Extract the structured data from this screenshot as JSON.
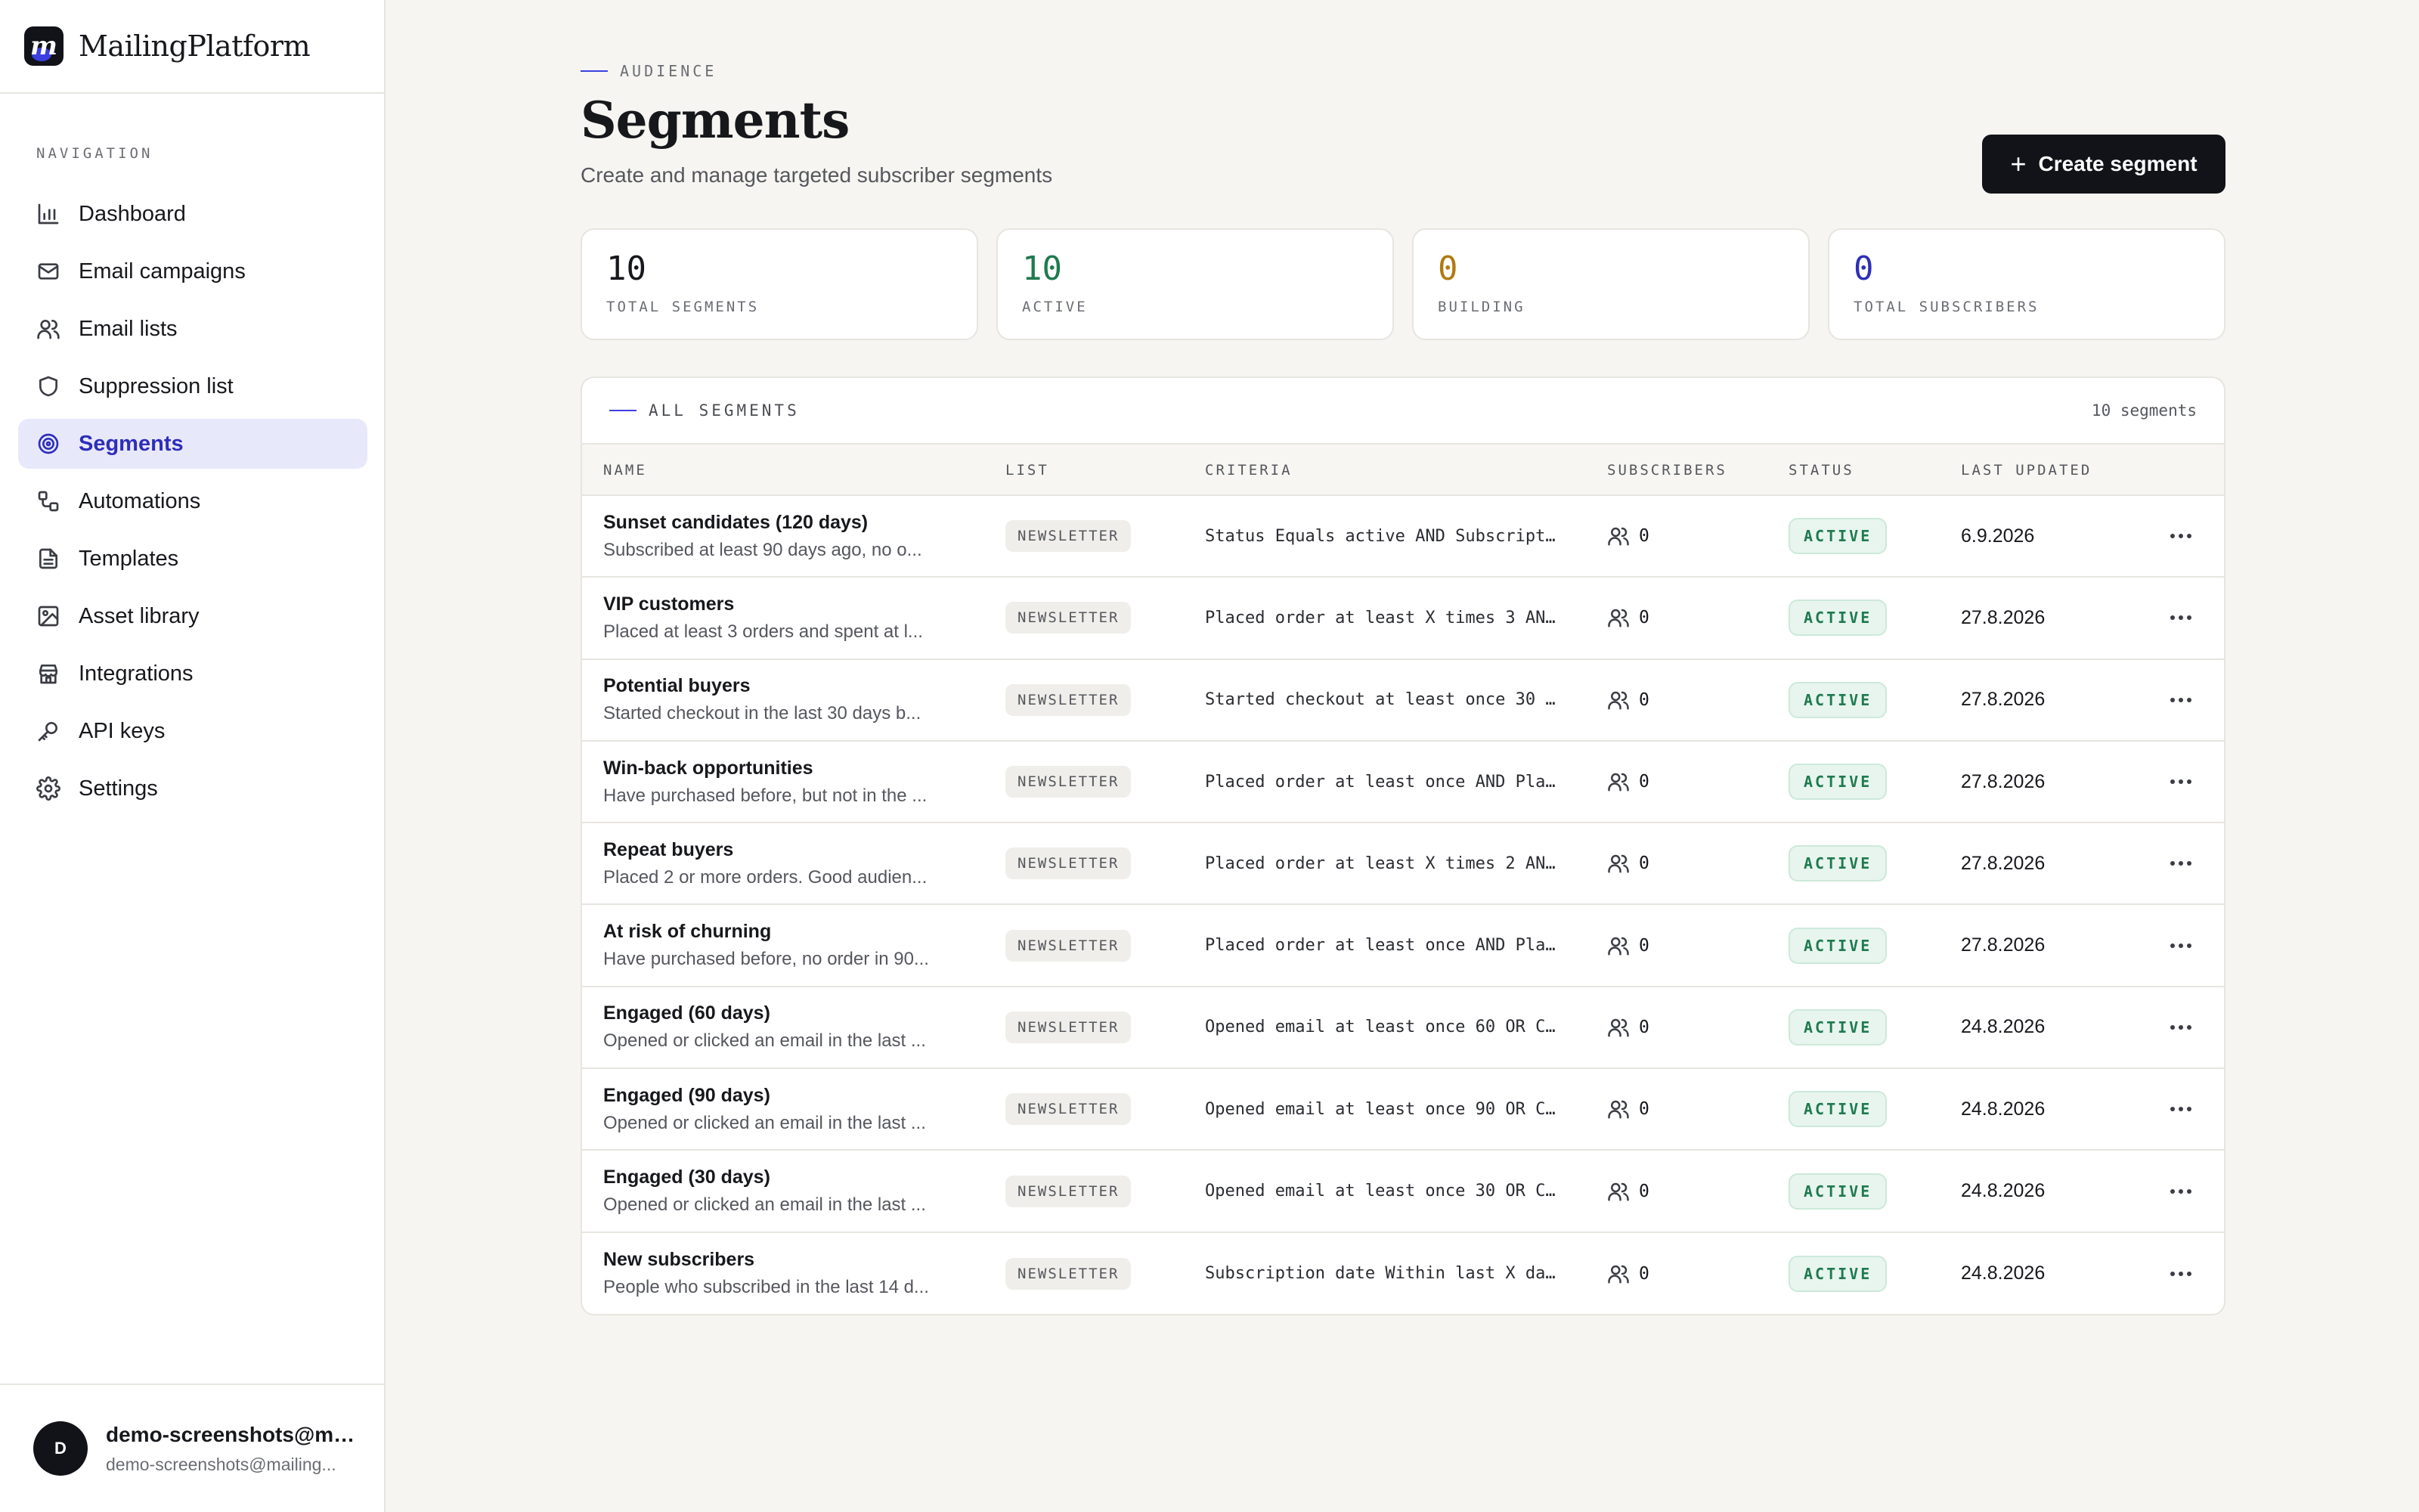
{
  "app": {
    "name": "MailingPlatform",
    "logo_letter": "m"
  },
  "sidebar": {
    "heading": "NAVIGATION",
    "items": [
      {
        "label": "Dashboard",
        "icon": "bar-chart-icon",
        "active": false
      },
      {
        "label": "Email campaigns",
        "icon": "mail-icon",
        "active": false
      },
      {
        "label": "Email lists",
        "icon": "users-icon",
        "active": false
      },
      {
        "label": "Suppression list",
        "icon": "shield-icon",
        "active": false
      },
      {
        "label": "Segments",
        "icon": "target-icon",
        "active": true
      },
      {
        "label": "Automations",
        "icon": "workflow-icon",
        "active": false
      },
      {
        "label": "Templates",
        "icon": "file-text-icon",
        "active": false
      },
      {
        "label": "Asset library",
        "icon": "image-icon",
        "active": false
      },
      {
        "label": "Integrations",
        "icon": "store-icon",
        "active": false
      },
      {
        "label": "API keys",
        "icon": "key-icon",
        "active": false
      },
      {
        "label": "Settings",
        "icon": "gear-icon",
        "active": false
      }
    ],
    "user": {
      "initial": "D",
      "name": "demo-screenshots@ma...",
      "email": "demo-screenshots@mailing..."
    }
  },
  "header": {
    "eyebrow": "AUDIENCE",
    "title": "Segments",
    "subtitle": "Create and manage targeted subscriber segments",
    "create_label": "Create segment"
  },
  "stats": [
    {
      "value": "10",
      "label": "TOTAL SEGMENTS",
      "color": "#17181c"
    },
    {
      "value": "10",
      "label": "ACTIVE",
      "color": "#1f7a4f"
    },
    {
      "value": "0",
      "label": "BUILDING",
      "color": "#b07a10"
    },
    {
      "value": "0",
      "label": "TOTAL SUBSCRIBERS",
      "color": "#2d2fb8"
    }
  ],
  "table": {
    "title": "ALL SEGMENTS",
    "count": "10 segments",
    "columns": {
      "name": "NAME",
      "list": "LIST",
      "criteria": "CRITERIA",
      "subscribers": "SUBSCRIBERS",
      "status": "STATUS",
      "updated": "LAST UPDATED"
    },
    "rows": [
      {
        "name": "Sunset candidates (120 days)",
        "desc": "Subscribed at least 90 days ago, no o...",
        "list": "NEWSLETTER",
        "criteria": "Status Equals active AND Subscriptio…",
        "subs": "0",
        "status": "ACTIVE",
        "updated": "6.9.2026"
      },
      {
        "name": "VIP customers",
        "desc": "Placed at least 3 orders and spent at l...",
        "list": "NEWSLETTER",
        "criteria": "Placed order at least X times 3 AND …",
        "subs": "0",
        "status": "ACTIVE",
        "updated": "27.8.2026"
      },
      {
        "name": "Potential buyers",
        "desc": "Started checkout in the last 30 days b...",
        "list": "NEWSLETTER",
        "criteria": "Started checkout at least once 30 AN…",
        "subs": "0",
        "status": "ACTIVE",
        "updated": "27.8.2026"
      },
      {
        "name": "Win-back opportunities",
        "desc": "Have purchased before, but not in the ...",
        "list": "NEWSLETTER",
        "criteria": "Placed order at least once AND Place…",
        "subs": "0",
        "status": "ACTIVE",
        "updated": "27.8.2026"
      },
      {
        "name": "Repeat buyers",
        "desc": "Placed 2 or more orders. Good audien...",
        "list": "NEWSLETTER",
        "criteria": "Placed order at least X times 2 AND …",
        "subs": "0",
        "status": "ACTIVE",
        "updated": "27.8.2026"
      },
      {
        "name": "At risk of churning",
        "desc": "Have purchased before, no order in 90...",
        "list": "NEWSLETTER",
        "criteria": "Placed order at least once AND Place…",
        "subs": "0",
        "status": "ACTIVE",
        "updated": "27.8.2026"
      },
      {
        "name": "Engaged (60 days)",
        "desc": "Opened or clicked an email in the last ...",
        "list": "NEWSLETTER",
        "criteria": "Opened email at least once 60 OR Cli…",
        "subs": "0",
        "status": "ACTIVE",
        "updated": "24.8.2026"
      },
      {
        "name": "Engaged (90 days)",
        "desc": "Opened or clicked an email in the last ...",
        "list": "NEWSLETTER",
        "criteria": "Opened email at least once 90 OR Cli…",
        "subs": "0",
        "status": "ACTIVE",
        "updated": "24.8.2026"
      },
      {
        "name": "Engaged (30 days)",
        "desc": "Opened or clicked an email in the last ...",
        "list": "NEWSLETTER",
        "criteria": "Opened email at least once 30 OR Cli…",
        "subs": "0",
        "status": "ACTIVE",
        "updated": "24.8.2026"
      },
      {
        "name": "New subscribers",
        "desc": "People who subscribed in the last 14 d...",
        "list": "NEWSLETTER",
        "criteria": "Subscription date Within last X days…",
        "subs": "0",
        "status": "ACTIVE",
        "updated": "24.8.2026"
      }
    ]
  }
}
